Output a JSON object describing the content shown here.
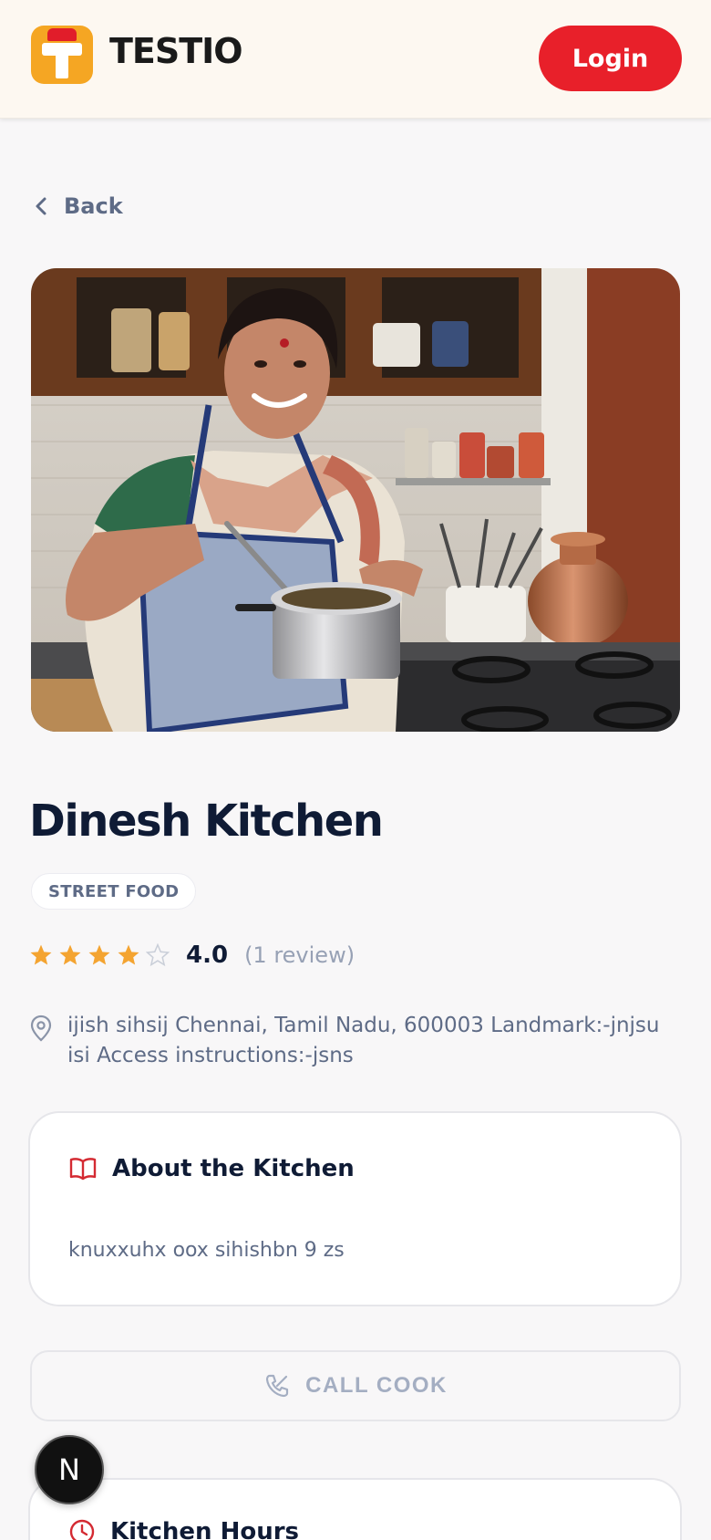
{
  "header": {
    "brand": "TESTIO",
    "login_label": "Login"
  },
  "nav": {
    "back_label": "Back"
  },
  "kitchen": {
    "name": "Dinesh Kitchen",
    "category": "STREET FOOD",
    "rating": 4.0,
    "rating_label": "4.0",
    "review_count_label": "(1 review)",
    "stars_filled": 4,
    "stars_total": 5,
    "address": "ijish sihsij Chennai, Tamil Nadu, 600003 Landmark:-jnjsu isi Access instructions:-jsns"
  },
  "about": {
    "title": "About the Kitchen",
    "text": "knuxxuhx oox sihishbn 9 zs"
  },
  "actions": {
    "call_label": "CALL COOK"
  },
  "hours": {
    "title": "Kitchen Hours"
  },
  "fab": {
    "label": "N"
  },
  "colors": {
    "brand_orange": "#f5a623",
    "brand_red": "#e8202a",
    "star_gold": "#f4a431",
    "text_dark": "#0f1b35",
    "text_muted": "#5e6b86"
  },
  "icons": {
    "back": "chevron-left-icon",
    "location": "map-pin-icon",
    "about": "book-open-icon",
    "call": "phone-off-icon",
    "hours": "clock-icon",
    "star": "star-icon"
  }
}
